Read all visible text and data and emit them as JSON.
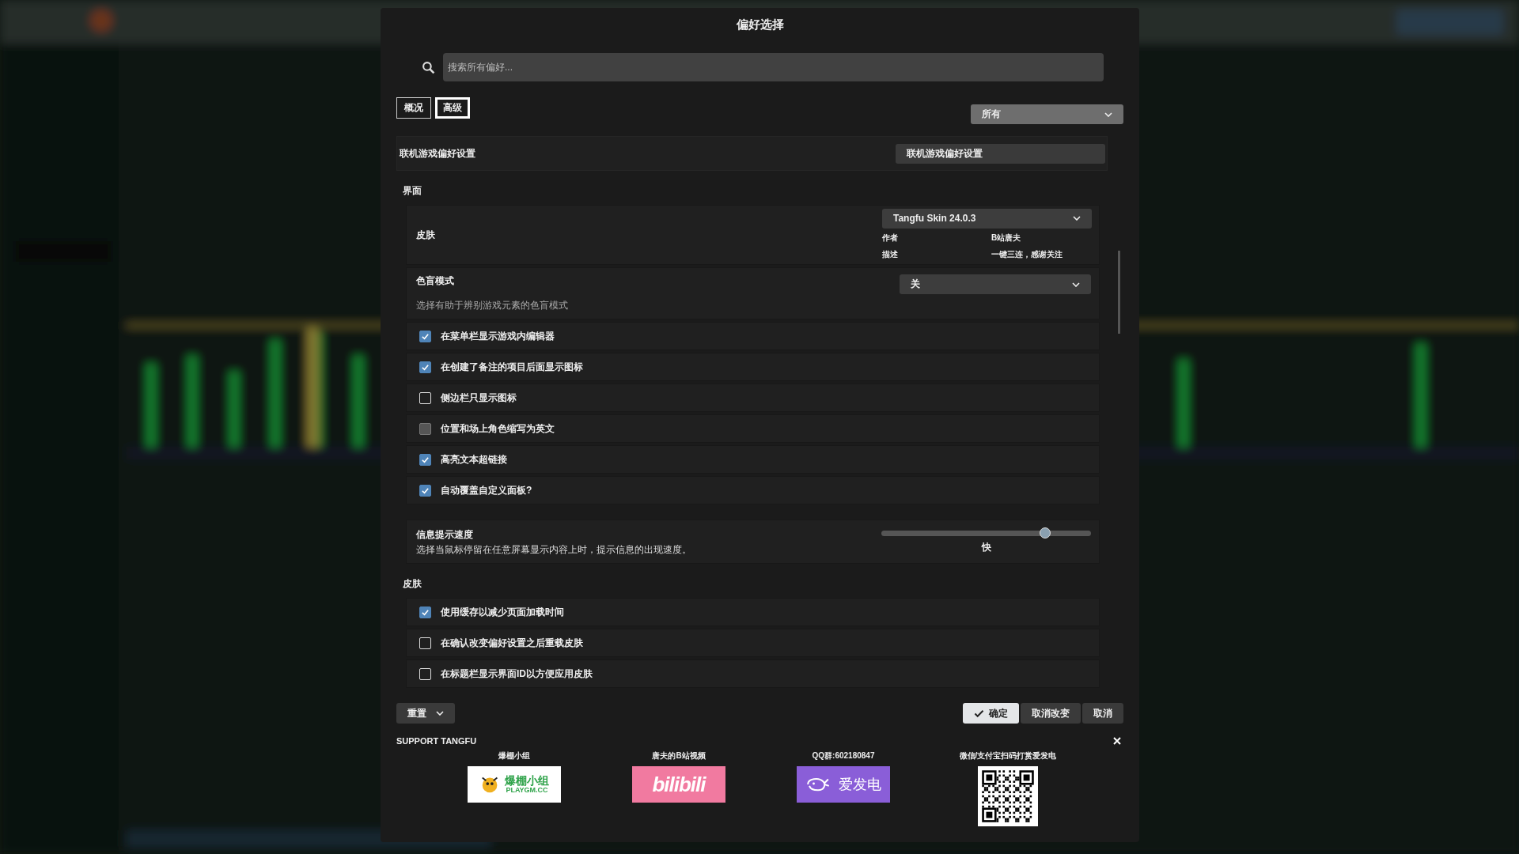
{
  "dialog": {
    "title": "偏好选择"
  },
  "search": {
    "placeholder": "搜索所有偏好..."
  },
  "tabs": [
    {
      "label": "概况",
      "selected": false
    },
    {
      "label": "高级",
      "selected": true
    }
  ],
  "filter": {
    "value": "所有"
  },
  "settings": [
    {
      "kind": "button",
      "label": "联机游戏偏好设置",
      "button": "联机游戏偏好设置"
    },
    {
      "kind": "heading",
      "label": "界面"
    },
    {
      "kind": "skin",
      "label": "皮肤",
      "value": "Tangfu Skin 24.0.3",
      "details": [
        {
          "key": "作者",
          "value": "B站唐夫"
        },
        {
          "key": "描述",
          "value": "一键三连，感谢关注"
        }
      ]
    },
    {
      "kind": "select",
      "label": "色盲模式",
      "description": "选择有助于辨别游戏元素的色盲模式",
      "value": "关"
    },
    {
      "kind": "checkbox",
      "label": "在菜单栏显示游戏内编辑器",
      "checked": true,
      "disabled": false
    },
    {
      "kind": "checkbox",
      "label": "在创建了备注的项目后面显示图标",
      "checked": true,
      "disabled": false
    },
    {
      "kind": "checkbox",
      "label": "侧边栏只显示图标",
      "checked": false,
      "disabled": false
    },
    {
      "kind": "checkbox",
      "label": "位置和场上角色缩写为英文",
      "checked": false,
      "disabled": true
    },
    {
      "kind": "checkbox",
      "label": "高亮文本超链接",
      "checked": true,
      "disabled": false
    },
    {
      "kind": "checkbox",
      "label": "自动覆盖自定义面板?",
      "checked": true,
      "disabled": false
    },
    {
      "kind": "slider",
      "label": "信息提示速度",
      "description": "选择当鼠标停留在任意屏幕显示内容上时，提示信息的出现速度。",
      "level": 0.78,
      "reading": "快"
    },
    {
      "kind": "heading",
      "label": "皮肤"
    },
    {
      "kind": "checkbox",
      "label": "使用缓存以减少页面加载时间",
      "checked": true,
      "disabled": false
    },
    {
      "kind": "checkbox",
      "label": "在确认改变偏好设置之后重载皮肤",
      "checked": false,
      "disabled": false
    },
    {
      "kind": "checkbox",
      "label": "在标题栏显示界面ID以方便应用皮肤",
      "checked": false,
      "disabled": false
    }
  ],
  "footer": {
    "reset": "重置",
    "buttons": [
      {
        "label": "确定",
        "kind": "primary"
      },
      {
        "label": "取消改变",
        "kind": "secondary"
      },
      {
        "label": "取消",
        "kind": "secondary"
      }
    ]
  },
  "support": {
    "title": "SUPPORT TANGFU",
    "links": [
      {
        "label": "爆棚小组",
        "kind": "playgm",
        "logo_text": [
          "爆棚小组",
          "PLAYGM.CC"
        ]
      },
      {
        "label": "唐夫的B站视频",
        "kind": "bilibili",
        "logo_text": [
          "bilibili"
        ]
      },
      {
        "label": "QQ群:602180847",
        "kind": "afdian",
        "logo_text": [
          "爱发电"
        ]
      },
      {
        "label": "微信/支付宝扫码打赏爱发电",
        "kind": "qr"
      }
    ]
  }
}
